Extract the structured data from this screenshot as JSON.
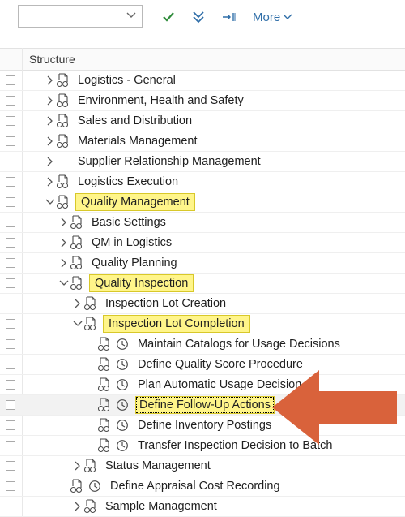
{
  "toolbar": {
    "dropdown_value": "",
    "more_label": "More",
    "accent": "#2f6ea8",
    "check_color": "#2e8b3a"
  },
  "table": {
    "column_header": "Structure"
  },
  "rows": [
    {
      "label": "Logistics - General",
      "expander": "collapsed",
      "icon": "node-doc-glasses-icon"
    },
    {
      "label": "Environment, Health and Safety",
      "expander": "collapsed",
      "icon": "node-doc-glasses-icon"
    },
    {
      "label": "Sales and Distribution",
      "expander": "collapsed",
      "icon": "node-doc-glasses-icon"
    },
    {
      "label": "Materials Management",
      "expander": "collapsed",
      "icon": "node-doc-glasses-icon"
    },
    {
      "label": "Supplier Relationship Management",
      "expander": "collapsed",
      "icon": null
    },
    {
      "label": "Logistics Execution",
      "expander": "collapsed",
      "icon": "node-doc-glasses-icon"
    },
    {
      "label": "Quality Management",
      "expander": "expanded",
      "icon": "node-doc-glasses-icon",
      "highlight": "yellow"
    },
    {
      "label": "Basic Settings",
      "expander": "collapsed",
      "icon": "node-doc-glasses-icon"
    },
    {
      "label": "QM in Logistics",
      "expander": "collapsed",
      "icon": "node-doc-glasses-icon"
    },
    {
      "label": "Quality Planning",
      "expander": "collapsed",
      "icon": "node-doc-glasses-icon"
    },
    {
      "label": "Quality Inspection",
      "expander": "expanded",
      "icon": "node-doc-glasses-icon",
      "highlight": "yellow"
    },
    {
      "label": "Inspection Lot Creation",
      "expander": "collapsed",
      "icon": "node-doc-glasses-icon"
    },
    {
      "label": "Inspection Lot Completion",
      "expander": "expanded",
      "icon": "node-doc-glasses-icon",
      "highlight": "yellow"
    },
    {
      "label": "Maintain Catalogs for Usage Decisions",
      "expander": "none",
      "icon": "node-doc-glasses-icon",
      "clock": "clock-icon"
    },
    {
      "label": "Define Quality Score Procedure",
      "expander": "none",
      "icon": "node-doc-glasses-icon",
      "clock": "clock-icon"
    },
    {
      "label": "Plan Automatic Usage Decision",
      "expander": "none",
      "icon": "node-doc-glasses-icon",
      "clock": "clock-icon"
    },
    {
      "label": "Define Follow-Up Actions",
      "expander": "none",
      "icon": "node-doc-glasses-icon",
      "clock": "clock-icon",
      "highlight": "focus",
      "selected": true
    },
    {
      "label": "Define Inventory Postings",
      "expander": "none",
      "icon": "node-doc-glasses-icon",
      "clock": "clock-icon"
    },
    {
      "label": "Transfer Inspection Decision to Batch",
      "expander": "none",
      "icon": "node-doc-glasses-icon",
      "clock": "clock-icon"
    },
    {
      "label": "Status Management",
      "expander": "collapsed",
      "icon": "node-doc-glasses-icon"
    },
    {
      "label": "Define Appraisal Cost Recording",
      "expander": "none",
      "icon": "node-doc-glasses-icon",
      "clock": "clock-icon"
    },
    {
      "label": "Sample Management",
      "expander": "collapsed",
      "icon": "node-doc-glasses-icon"
    }
  ],
  "annotation": {
    "arrow_color": "#d9623b"
  }
}
